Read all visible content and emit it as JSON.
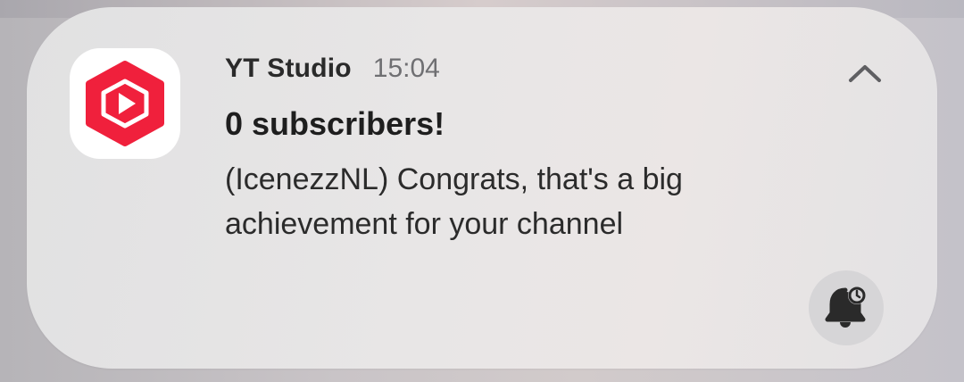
{
  "notification": {
    "app_name": "YT Studio",
    "time": "15:04",
    "title": "0 subscribers!",
    "body": "(IcenezzNL) Congrats, that's a big achievement for your channel",
    "app_icon": "yt-studio-icon",
    "collapse_icon": "chevron-up-icon",
    "action_icon": "bell-snooze-icon"
  },
  "colors": {
    "brand_red": "#f0203c",
    "icon_bg": "#ffffff",
    "text_primary": "#1e1e1e",
    "text_secondary": "#6f6f72"
  }
}
